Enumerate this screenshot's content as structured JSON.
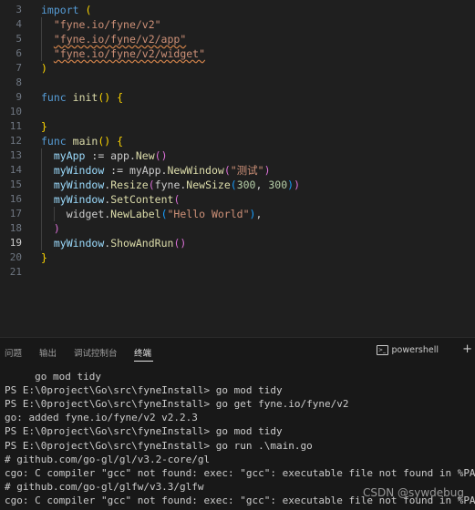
{
  "editor": {
    "lines": [
      {
        "num": "3",
        "tokens": [
          {
            "t": "import",
            "c": "#569cd6"
          },
          {
            "t": " (",
            "c": "#ffd700"
          }
        ]
      },
      {
        "num": "4",
        "tokens": [
          {
            "t": "  ",
            "c": "#cccccc"
          },
          {
            "t": "\"fyne.io/fyne/v2\"",
            "c": "#ce9178"
          }
        ]
      },
      {
        "num": "5",
        "tokens": [
          {
            "t": "  ",
            "c": "#cccccc"
          },
          {
            "t": "\"fyne.io/fyne/v2/app\"",
            "c": "#ce9178",
            "sq": true
          }
        ]
      },
      {
        "num": "6",
        "tokens": [
          {
            "t": "  ",
            "c": "#cccccc"
          },
          {
            "t": "\"fyne.io/fyne/v2/widget\"",
            "c": "#ce9178",
            "sq": true
          }
        ]
      },
      {
        "num": "7",
        "tokens": [
          {
            "t": ")",
            "c": "#ffd700"
          }
        ]
      },
      {
        "num": "8",
        "tokens": []
      },
      {
        "num": "9",
        "tokens": [
          {
            "t": "func",
            "c": "#569cd6"
          },
          {
            "t": " ",
            "c": "#cccccc"
          },
          {
            "t": "init",
            "c": "#dcdcaa"
          },
          {
            "t": "()",
            "c": "#ffd700"
          },
          {
            "t": " ",
            "c": "#cccccc"
          },
          {
            "t": "{",
            "c": "#ffd700"
          }
        ]
      },
      {
        "num": "10",
        "tokens": []
      },
      {
        "num": "11",
        "tokens": [
          {
            "t": "}",
            "c": "#ffd700"
          }
        ]
      },
      {
        "num": "12",
        "tokens": [
          {
            "t": "func",
            "c": "#569cd6"
          },
          {
            "t": " ",
            "c": "#cccccc"
          },
          {
            "t": "main",
            "c": "#dcdcaa"
          },
          {
            "t": "()",
            "c": "#ffd700"
          },
          {
            "t": " ",
            "c": "#cccccc"
          },
          {
            "t": "{",
            "c": "#ffd700"
          }
        ]
      },
      {
        "num": "13",
        "tokens": [
          {
            "t": "  ",
            "c": "#cccccc"
          },
          {
            "t": "myApp",
            "c": "#9cdcfe"
          },
          {
            "t": " := app.",
            "c": "#cccccc"
          },
          {
            "t": "New",
            "c": "#dcdcaa"
          },
          {
            "t": "()",
            "c": "#da70d6"
          }
        ]
      },
      {
        "num": "14",
        "tokens": [
          {
            "t": "  ",
            "c": "#cccccc"
          },
          {
            "t": "myWindow",
            "c": "#9cdcfe"
          },
          {
            "t": " := myApp.",
            "c": "#cccccc"
          },
          {
            "t": "NewWindow",
            "c": "#dcdcaa"
          },
          {
            "t": "(",
            "c": "#da70d6"
          },
          {
            "t": "\"测试\"",
            "c": "#ce9178"
          },
          {
            "t": ")",
            "c": "#da70d6"
          }
        ]
      },
      {
        "num": "15",
        "tokens": [
          {
            "t": "  ",
            "c": "#cccccc"
          },
          {
            "t": "myWindow",
            "c": "#9cdcfe"
          },
          {
            "t": ".",
            "c": "#cccccc"
          },
          {
            "t": "Resize",
            "c": "#dcdcaa"
          },
          {
            "t": "(",
            "c": "#da70d6"
          },
          {
            "t": "fyne.",
            "c": "#cccccc"
          },
          {
            "t": "NewSize",
            "c": "#dcdcaa"
          },
          {
            "t": "(",
            "c": "#179fff"
          },
          {
            "t": "300",
            "c": "#b5cea8"
          },
          {
            "t": ", ",
            "c": "#cccccc"
          },
          {
            "t": "300",
            "c": "#b5cea8"
          },
          {
            "t": ")",
            "c": "#179fff"
          },
          {
            "t": ")",
            "c": "#da70d6"
          }
        ]
      },
      {
        "num": "16",
        "tokens": [
          {
            "t": "  ",
            "c": "#cccccc"
          },
          {
            "t": "myWindow",
            "c": "#9cdcfe"
          },
          {
            "t": ".",
            "c": "#cccccc"
          },
          {
            "t": "SetContent",
            "c": "#dcdcaa"
          },
          {
            "t": "(",
            "c": "#da70d6"
          }
        ]
      },
      {
        "num": "17",
        "tokens": [
          {
            "t": "    ",
            "c": "#cccccc"
          },
          {
            "t": "widget.",
            "c": "#cccccc"
          },
          {
            "t": "NewLabel",
            "c": "#dcdcaa"
          },
          {
            "t": "(",
            "c": "#179fff"
          },
          {
            "t": "\"Hello World\"",
            "c": "#ce9178"
          },
          {
            "t": ")",
            "c": "#179fff"
          },
          {
            "t": ",",
            "c": "#cccccc"
          }
        ]
      },
      {
        "num": "18",
        "tokens": [
          {
            "t": "  ",
            "c": "#cccccc"
          },
          {
            "t": ")",
            "c": "#da70d6"
          }
        ]
      },
      {
        "num": "19",
        "active": true,
        "tokens": [
          {
            "t": "  ",
            "c": "#cccccc"
          },
          {
            "t": "myWindow",
            "c": "#9cdcfe"
          },
          {
            "t": ".",
            "c": "#cccccc"
          },
          {
            "t": "ShowAndRun",
            "c": "#dcdcaa"
          },
          {
            "t": "()",
            "c": "#da70d6"
          }
        ]
      },
      {
        "num": "20",
        "tokens": [
          {
            "t": "}",
            "c": "#ffd700"
          }
        ]
      },
      {
        "num": "21",
        "tokens": []
      }
    ]
  },
  "panel": {
    "tabs": [
      {
        "label": "问题",
        "active": false
      },
      {
        "label": "输出",
        "active": false
      },
      {
        "label": "调试控制台",
        "active": false
      },
      {
        "label": "终端",
        "active": true
      }
    ],
    "shell_label": "powershell",
    "shell_icon": "terminal-icon",
    "add_icon": "plus-icon",
    "terminal_lines": [
      "     go mod tidy",
      "PS E:\\0project\\Go\\src\\fyneInstall> go mod tidy",
      "PS E:\\0project\\Go\\src\\fyneInstall> go get fyne.io/fyne/v2",
      "go: added fyne.io/fyne/v2 v2.2.3",
      "PS E:\\0project\\Go\\src\\fyneInstall> go mod tidy",
      "PS E:\\0project\\Go\\src\\fyneInstall> go run .\\main.go",
      "# github.com/go-gl/gl/v3.2-core/gl",
      "cgo: C compiler \"gcc\" not found: exec: \"gcc\": executable file not found in %PATH%",
      "# github.com/go-gl/glfw/v3.3/glfw",
      "cgo: C compiler \"gcc\" not found: exec: \"gcc\": executable file not found in %PATH%"
    ]
  },
  "watermark": "CSDN @sywdebug"
}
